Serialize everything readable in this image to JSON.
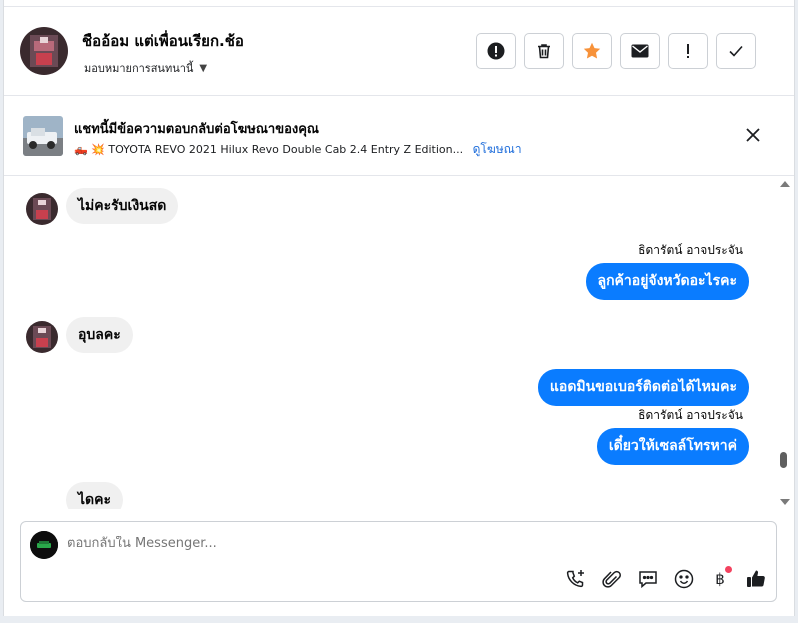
{
  "header": {
    "contact_name": "ชืออ้อม แต่เพื่อนเรียก.ช้อ",
    "assign_label": "มอบหมายการสนทนานี้",
    "actions": [
      "report-icon",
      "trash-icon",
      "star-icon",
      "envelope-icon",
      "exclamation-icon",
      "check-icon"
    ]
  },
  "ad": {
    "title": "แชทนี้มีข้อความตอบกลับต่อโฆษณาของคุณ",
    "description": "🛻 💥 TOYOTA REVO 2021 Hilux Revo Double Cab 2.4 Entry Z Edition...",
    "view_ad_link": "ดูโฆษณา"
  },
  "messages": [
    {
      "direction": "in",
      "text": "ไม่คะรับเงินสด"
    },
    {
      "direction": "out",
      "sender": "ธิดารัตน์ อาจประจัน",
      "text": "ลูกค้าอยู่จังหวัดอะไรคะ"
    },
    {
      "direction": "in",
      "text": "อุบลคะ"
    },
    {
      "direction": "out",
      "text": "แอดมินขอเบอร์ติดต่อได้ไหมคะ"
    },
    {
      "direction": "out",
      "sender": "ธิดารัตน์ อาจประจัน",
      "text": "เดี๋ยวให้เซลล์โทรหาค่"
    },
    {
      "direction": "in",
      "text": "ไดคะ"
    }
  ],
  "composer": {
    "placeholder": "ตอบกลับใน Messenger...",
    "tools": [
      "add-call-icon",
      "paperclip-icon",
      "chat-bubble-icon",
      "emoji-icon",
      "baht-icon",
      "thumbs-up-icon"
    ],
    "baht_symbol": "฿"
  },
  "colors": {
    "accent": "#0a7cff",
    "star": "#f7923a",
    "notification": "#f3425f"
  }
}
